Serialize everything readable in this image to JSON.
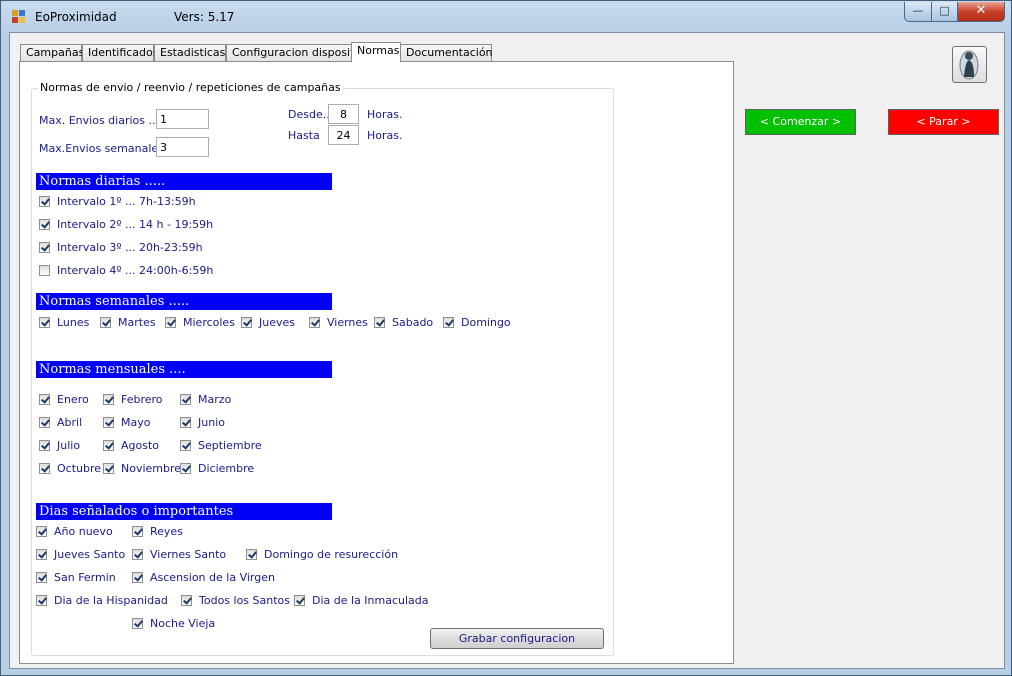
{
  "window": {
    "title": "EoProximidad",
    "version": "Vers: 5.17",
    "min_glyph": "—",
    "max_glyph": "□",
    "close_glyph": "✕"
  },
  "tabs": [
    {
      "label": "Campañas"
    },
    {
      "label": "Identificados"
    },
    {
      "label": "Estadisticas"
    },
    {
      "label": "Configuracion dispositivo"
    },
    {
      "label": "Normas",
      "active": true
    },
    {
      "label": "Documentación"
    }
  ],
  "group": {
    "title": "Normas de envio / reenvio / repeticiones de campañas",
    "max_diarios_label": "Max. Envios diarios ...",
    "max_diarios_value": "1",
    "max_semanales_label": "Max.Envios semanales..",
    "max_semanales_value": "3",
    "desde_label": "Desde..",
    "desde_value": "8",
    "desde_unit": "Horas.",
    "hasta_label": "Hasta",
    "hasta_value": "24",
    "hasta_unit": "Horas."
  },
  "diarias": {
    "title": "Normas diarias .....",
    "items": [
      {
        "label": "Intervalo 1º ... 7h-13:59h",
        "checked": true
      },
      {
        "label": "Intervalo 2º ... 14 h - 19:59h",
        "checked": true
      },
      {
        "label": "Intervalo 3º ... 20h-23:59h",
        "checked": true
      },
      {
        "label": "Intervalo 4º ... 24:00h-6:59h",
        "checked": false
      }
    ]
  },
  "semanales": {
    "title": "Normas semanales .....",
    "items": [
      {
        "label": "Lunes",
        "checked": true
      },
      {
        "label": "Martes",
        "checked": true
      },
      {
        "label": "Miercoles",
        "checked": true
      },
      {
        "label": "Jueves",
        "checked": true
      },
      {
        "label": "Viernes",
        "checked": true
      },
      {
        "label": "Sabado",
        "checked": true
      },
      {
        "label": "Domingo",
        "checked": true
      }
    ]
  },
  "mensuales": {
    "title": "Normas mensuales ....",
    "items": [
      {
        "label": "Enero",
        "checked": true
      },
      {
        "label": "Febrero",
        "checked": true
      },
      {
        "label": "Marzo",
        "checked": true
      },
      {
        "label": "Abril",
        "checked": true
      },
      {
        "label": "Mayo",
        "checked": true
      },
      {
        "label": "Junio",
        "checked": true
      },
      {
        "label": "Julio",
        "checked": true
      },
      {
        "label": "Agosto",
        "checked": true
      },
      {
        "label": "Septiembre",
        "checked": true
      },
      {
        "label": "Octubre",
        "checked": true
      },
      {
        "label": "Noviembre",
        "checked": true
      },
      {
        "label": "Diciembre",
        "checked": true
      }
    ]
  },
  "senalados": {
    "title": "Dias señalados o importantes",
    "items": [
      {
        "label": "Año nuevo",
        "checked": true
      },
      {
        "label": "Reyes",
        "checked": true
      },
      {
        "label": "Jueves Santo",
        "checked": true
      },
      {
        "label": "Viernes Santo",
        "checked": true
      },
      {
        "label": "Domingo de resurección",
        "checked": true
      },
      {
        "label": "San Fermin",
        "checked": true
      },
      {
        "label": "Ascension de la Virgen",
        "checked": true
      },
      {
        "label": "Dia de la Hispanidad",
        "checked": true
      },
      {
        "label": "Todos los Santos",
        "checked": true
      },
      {
        "label": "Dia de la Inmaculada",
        "checked": true
      },
      {
        "label": "Noche Vieja",
        "checked": true
      }
    ]
  },
  "buttons": {
    "grabar": "Grabar configuracion",
    "comenzar": "< Comenzar >",
    "parar": "< Parar >"
  },
  "colors": {
    "banner": "#0000f6",
    "comenzar": "#00c000",
    "parar": "#ff0000"
  }
}
